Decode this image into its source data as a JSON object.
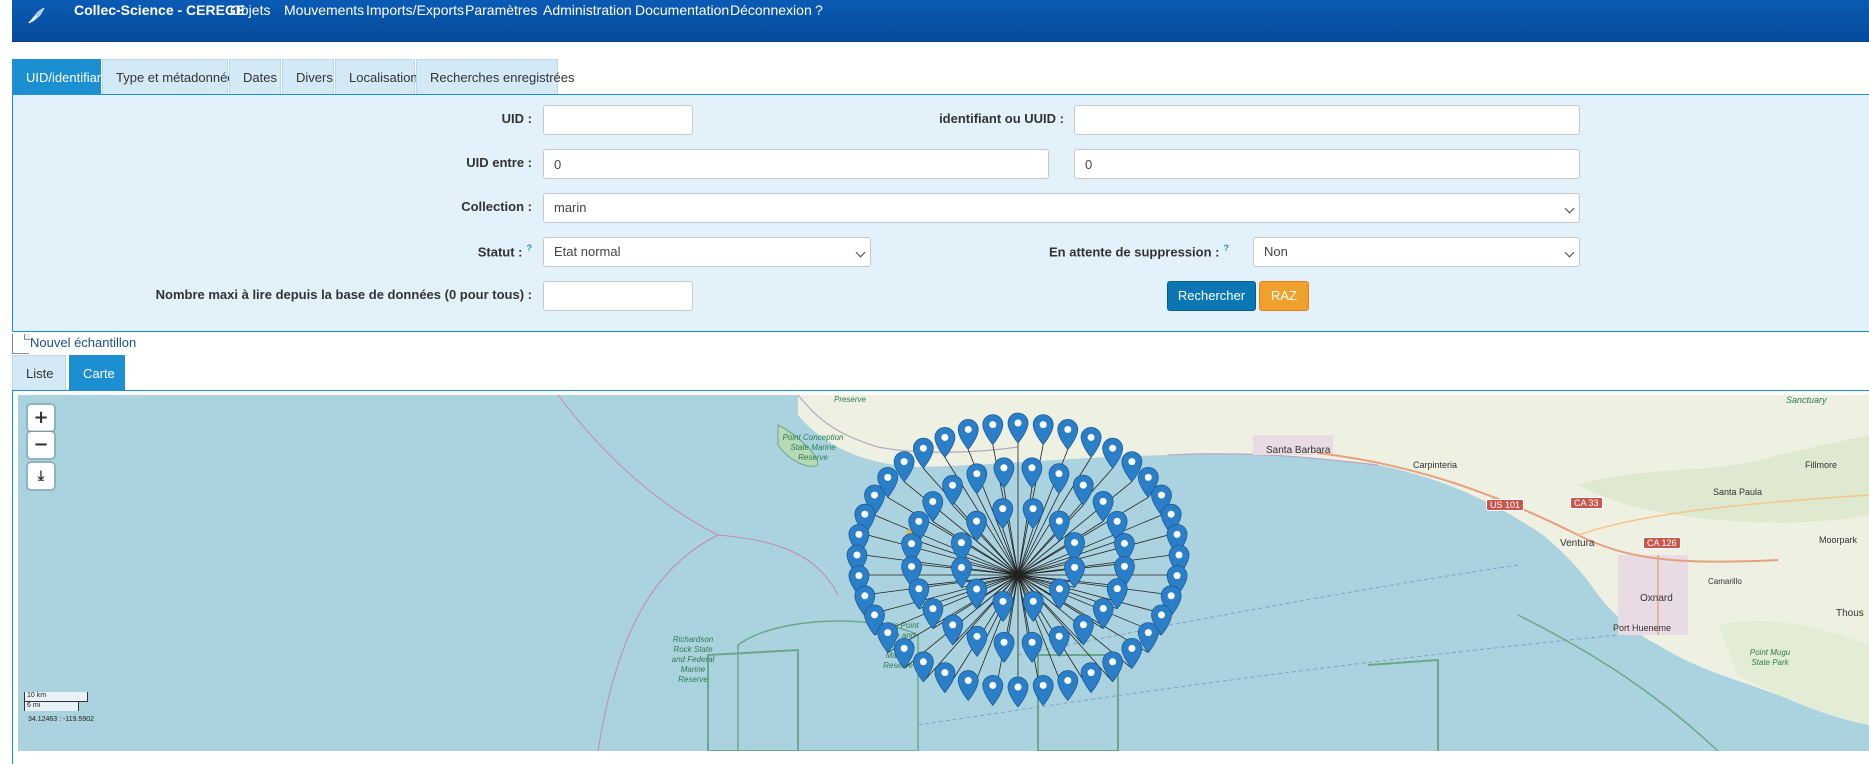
{
  "navbar": {
    "logo_icon": "quill-icon",
    "brand": "Collec-Science - CEREGE",
    "items": [
      "Objets",
      "Mouvements",
      "Imports/Exports",
      "Paramètres",
      "Administration",
      "Documentation",
      "Déconnexion",
      "?"
    ]
  },
  "search_tabs": [
    "UID/identifiant",
    "Type et métadonnées",
    "Dates",
    "Divers",
    "Localisation",
    "Recherches enregistrées"
  ],
  "form": {
    "uid_label": "UID :",
    "uid_value": "",
    "identifier_label": "identifiant ou UUID :",
    "identifier_value": "",
    "uid_between_label": "UID entre :",
    "uid_min": "0",
    "uid_max": "0",
    "collection_label": "Collection :",
    "collection_value": "marin",
    "status_label": "Statut :",
    "status_help": "?",
    "status_value": "Etat normal",
    "pending_delete_label": "En attente de suppression :",
    "pending_delete_help": "?",
    "pending_delete_value": "Non",
    "max_read_label": "Nombre maxi à lire depuis la base de données (0 pour tous) :",
    "max_read_value": "",
    "search_button": "Rechercher",
    "reset_button": "RAZ"
  },
  "new_sample_link": "Nouvel échantillon",
  "result_tabs": [
    "Liste",
    "Carte"
  ],
  "map": {
    "zoom_in": "+",
    "zoom_out": "−",
    "scale_km": "10 km",
    "scale_mi": "6 mi",
    "mouse_position": "34.12463 : -119.5902",
    "labels": {
      "santa_barbara": "Santa Barbara",
      "carpinteria": "Carpinteria",
      "ventura": "Ventura",
      "oxnard": "Oxnard",
      "port_hueneme": "Port Hueneme",
      "camarillo": "Camarillo",
      "santa_paula": "Santa Paula",
      "fillmore": "Fillmore",
      "moorpark": "Moorpark",
      "thousand_oaks": "Thous",
      "sanctuary": "Sanctuary"
    },
    "mpa_labels": {
      "point_conception": "Point Conception\nState Marine\nReserve",
      "richardson_rock": "Richardson\nRock State\nand Federal\nMarine\nReserve",
      "harris_point": "Harris Point\nState and\nFederal\nMarine\nReserve",
      "point_mugu": "Point Mugu\nState Park",
      "preserve": "Preserve"
    },
    "road_shields": {
      "us101": "US 101",
      "ca33": "CA 33",
      "ca126": "CA 126"
    },
    "marker_color": "#2a7fc8",
    "marker_rings": [
      40,
      24,
      12
    ],
    "icons": [
      "zoom-in-icon",
      "zoom-out-icon",
      "download-icon",
      "map-marker-icon"
    ]
  },
  "colors": {
    "navbar": "#0a5bb5",
    "tab_active": "#1c8fd3",
    "tab_inactive": "#d3e9f6",
    "panel_bg": "#e3f2fa",
    "btn_primary": "#0b76b4",
    "btn_warning": "#f0a02c",
    "sea": "#aad3df",
    "land": "#f2efe9",
    "mpa_line": "#6aa88a"
  }
}
